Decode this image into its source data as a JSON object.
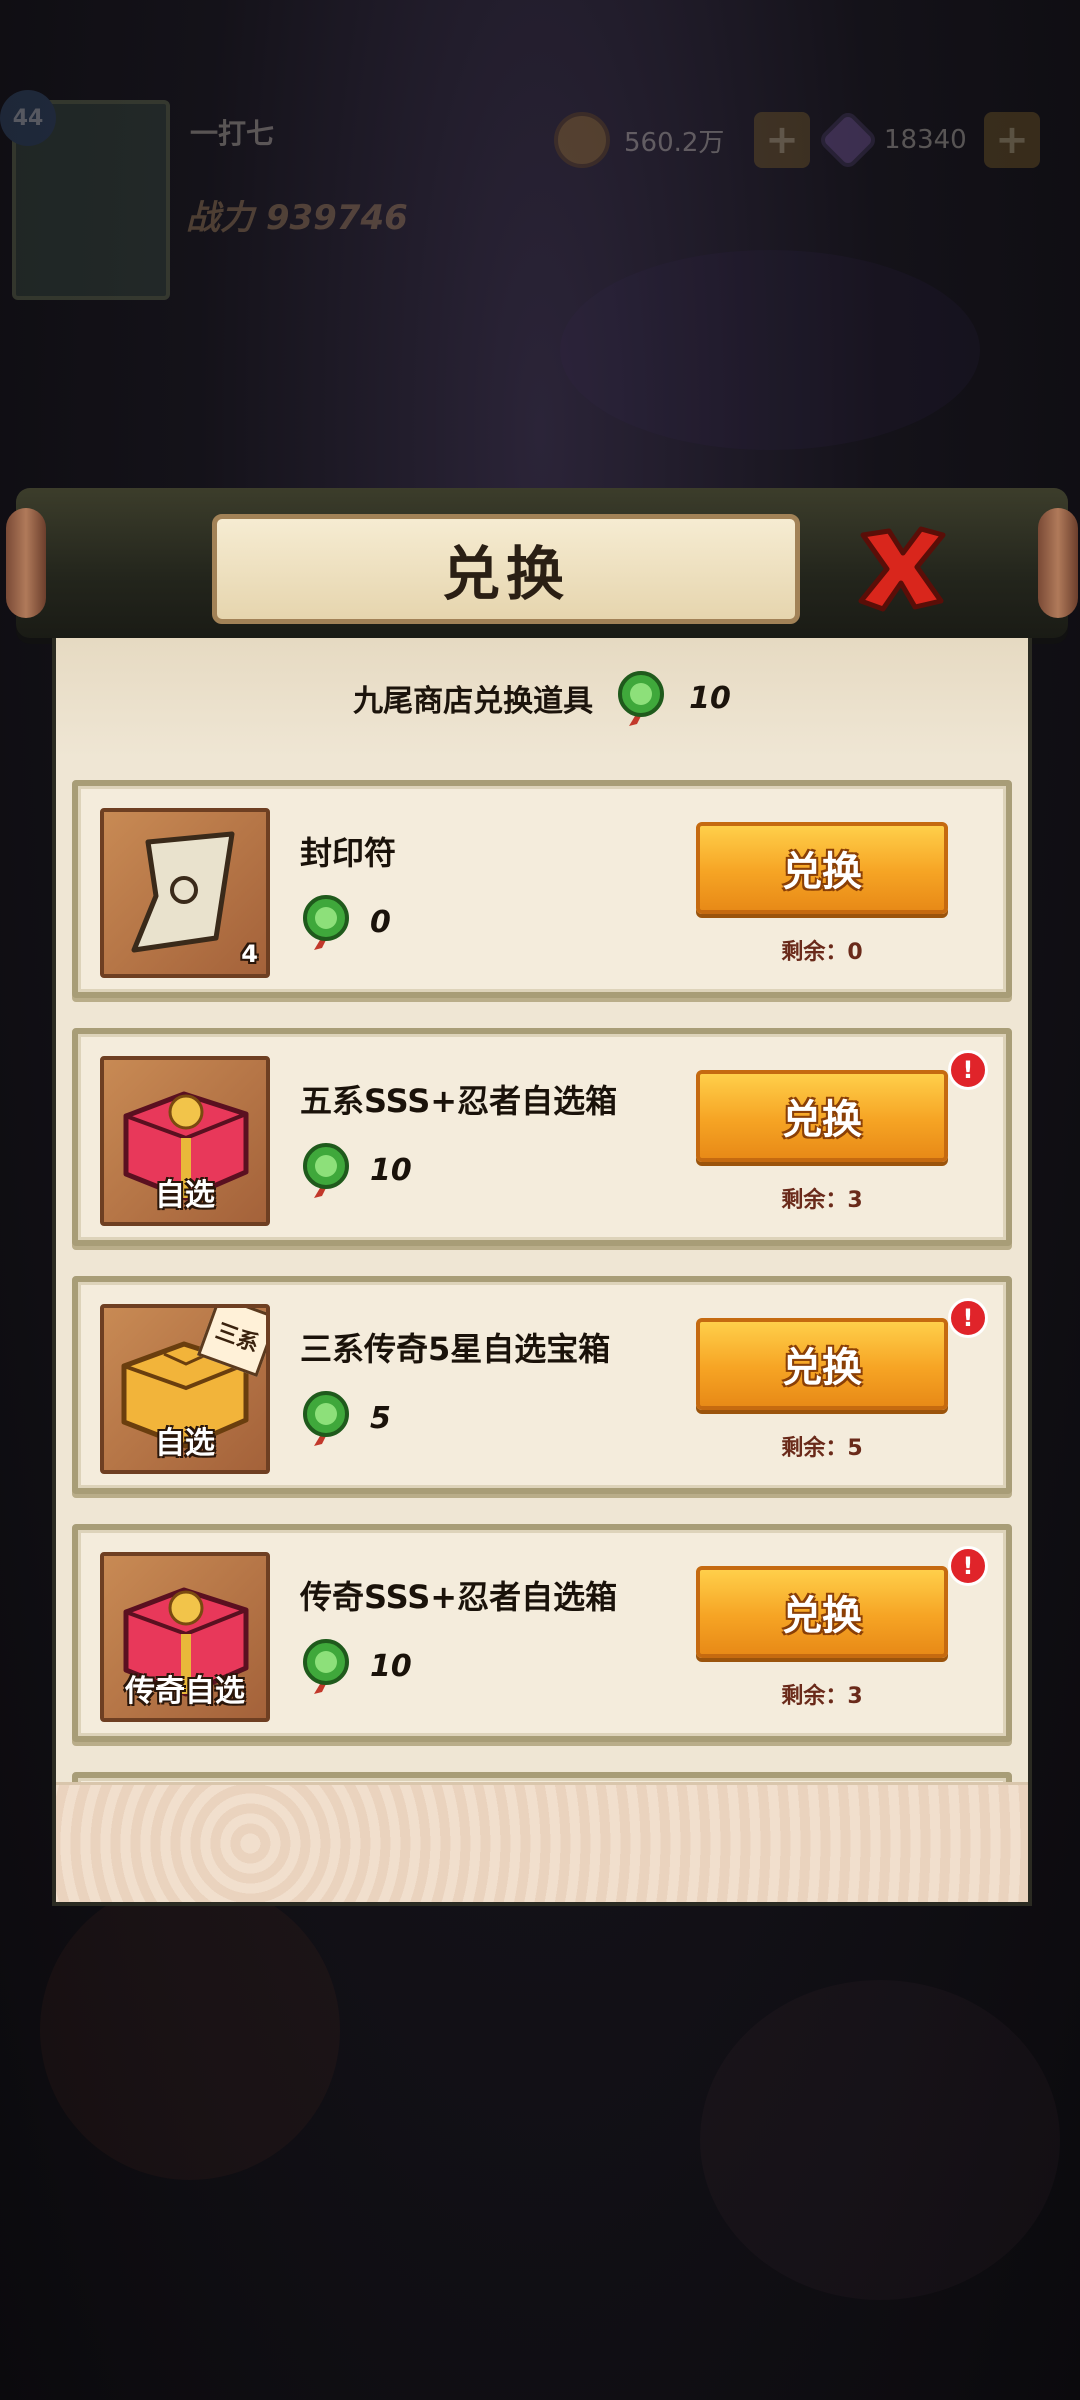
{
  "top_bar": {
    "level": "44",
    "player_name": "一打七",
    "power": "战力 939746",
    "gold": "560.2万",
    "gems": "18340",
    "plus_label": "+"
  },
  "dialog": {
    "title": "兑换",
    "currency_label": "九尾商店兑换道具",
    "currency_count": "10",
    "items": [
      {
        "name": "封印符",
        "cost": "0",
        "button": "兑换",
        "remaining": "剩余：0",
        "icon": "seal-scroll-icon",
        "icon_qty": "4",
        "icon_caption": "",
        "corner_tag": "",
        "alert": false
      },
      {
        "name": "五系SSS+忍者自选箱",
        "cost": "10",
        "button": "兑换",
        "remaining": "剩余：3",
        "icon": "red-chest-icon",
        "icon_qty": "",
        "icon_caption": "自选",
        "corner_tag": "",
        "alert": true
      },
      {
        "name": "三系传奇5星自选宝箱",
        "cost": "5",
        "button": "兑换",
        "remaining": "剩余：5",
        "icon": "gold-chest-icon",
        "icon_qty": "",
        "icon_caption": "自选",
        "corner_tag": "三系",
        "alert": true
      },
      {
        "name": "传奇SSS+忍者自选箱",
        "cost": "10",
        "button": "兑换",
        "remaining": "剩余：3",
        "icon": "red-chest-icon",
        "icon_qty": "",
        "icon_caption": "传奇自选",
        "corner_tag": "",
        "alert": true
      }
    ],
    "partial_item": {
      "icon": "purple-item-icon",
      "alert": true
    }
  },
  "colors": {
    "button_orange": "#f6a424",
    "alert_red": "#e0242a",
    "token_green": "#3fa83b",
    "paper": "#efe6d4"
  }
}
